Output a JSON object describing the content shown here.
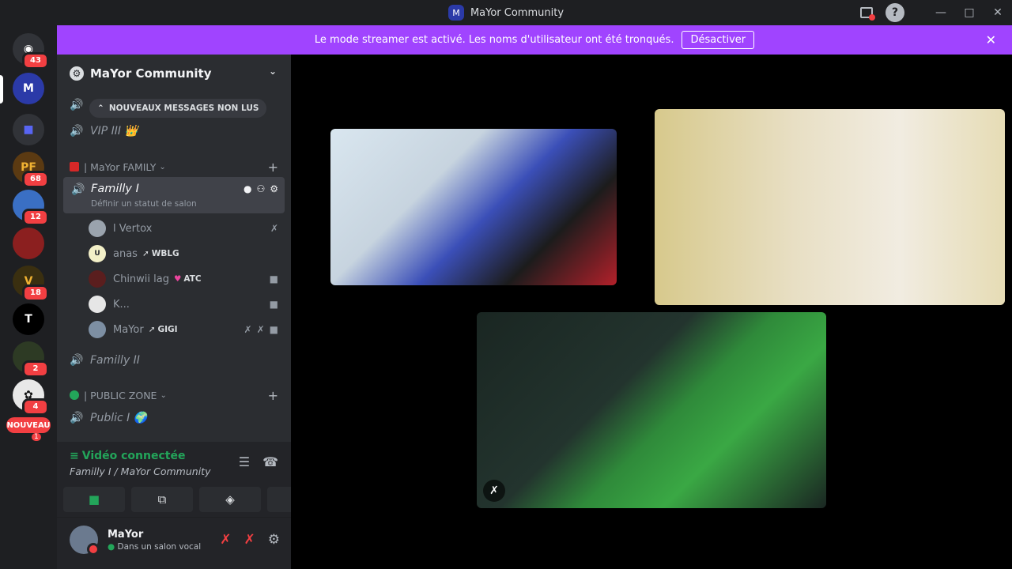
{
  "window": {
    "title": "MaYor Community"
  },
  "banner": {
    "text": "Le mode streamer est activé. Les noms d'utilisateur ont été tronqués.",
    "button": "Désactiver"
  },
  "rail": {
    "home_badge": "43",
    "badges": [
      "68",
      "12",
      "18",
      "2",
      "4"
    ],
    "new_label": "NOUVEAU",
    "new_count": "1"
  },
  "guild": {
    "name": "MaYor Community"
  },
  "channels": {
    "unread_pill": "NOUVEAUX MESSAGES NON LUS",
    "vip": "VIP III 👑",
    "cat_family": "| MaYor FAMILY",
    "family1": "Familly I",
    "family1_status": "Définir un statut de salon",
    "family2": "Familly II",
    "cat_public": "| PUBLIC ZONE",
    "public1": "Public I 🌍"
  },
  "members": [
    {
      "name": "l Vertox",
      "tag": ""
    },
    {
      "name": "anas",
      "tag": "WBLG"
    },
    {
      "name": "Chinwii lag",
      "tag": "ATC"
    },
    {
      "name": "K...",
      "tag": ""
    },
    {
      "name": "MaYor",
      "tag": "GIGI"
    }
  ],
  "voice": {
    "title": "Vidéo connectée",
    "channel": "Familly I / MaYor Community"
  },
  "user": {
    "name": "MaYor",
    "status": "Dans un salon vocal"
  },
  "colors": {
    "banner": "#a044ff",
    "connected": "#23a55a",
    "danger": "#f23f42"
  }
}
